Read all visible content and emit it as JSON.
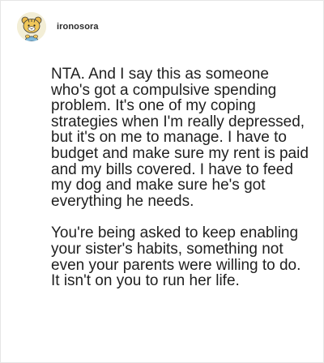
{
  "post": {
    "username": "ironosora",
    "avatar_icon": "tiger-mascot-avatar",
    "paragraphs": [
      "NTA. And I say this as someone who's got a compulsive spending problem. It's one of my coping strategies when I'm really depressed, but it's on me to manage. I have to budget and make sure my rent is paid and my bills covered. I have to feed my dog and make sure he's got everything he needs.",
      "You're being asked to keep enabling your sister's habits, something not even your parents were willing to do. It isn't on you to run her life."
    ]
  },
  "colors": {
    "text": "#1f1f1f",
    "border": "#e6e6e6",
    "background": "#ffffff"
  }
}
